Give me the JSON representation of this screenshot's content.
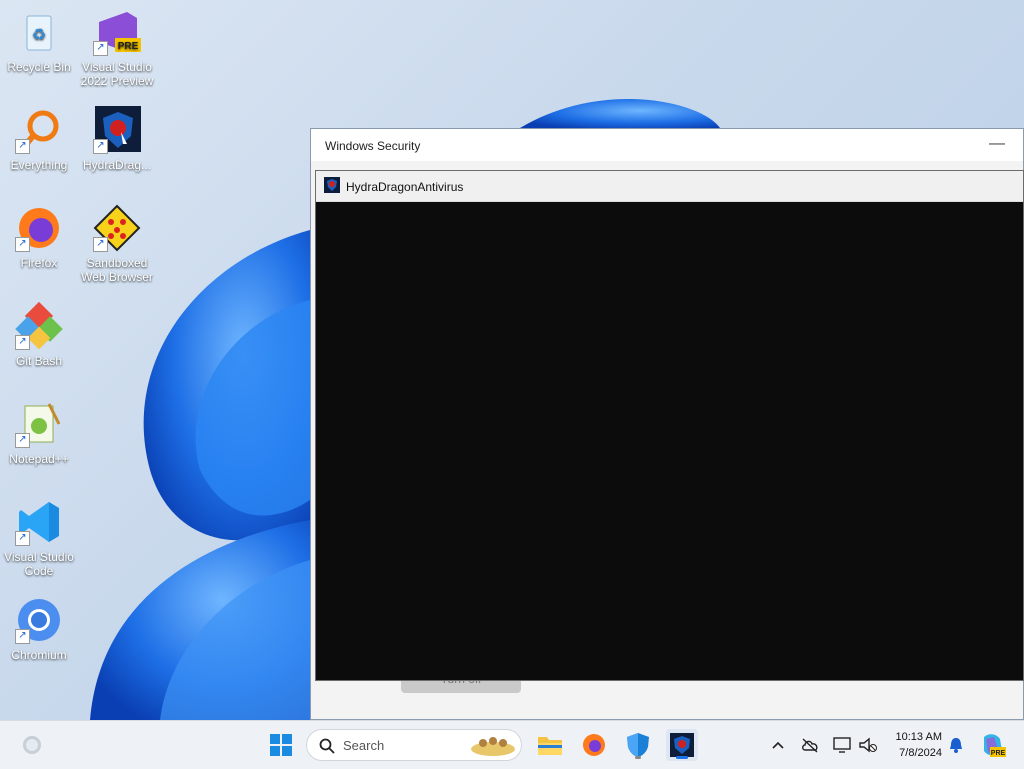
{
  "desktop": {
    "icons": [
      {
        "label": "Recycle Bin",
        "icon": "recycle-bin-icon"
      },
      {
        "label": "Visual Studio 2022 Preview",
        "icon": "visual-studio-icon",
        "badge": "PRE"
      },
      {
        "label": "Everything",
        "icon": "everything-search-icon"
      },
      {
        "label": "HydraDrag...",
        "icon": "hydradragon-icon"
      },
      {
        "label": "Firefox",
        "icon": "firefox-icon"
      },
      {
        "label": "Sandboxed Web Browser",
        "icon": "sandboxed-browser-icon"
      },
      {
        "label": "Git Bash",
        "icon": "git-bash-icon"
      },
      {
        "label": "Notepad++",
        "icon": "notepad-plus-plus-icon"
      },
      {
        "label": "Visual Studio Code",
        "icon": "vscode-icon"
      },
      {
        "label": "Chromium",
        "icon": "chromium-icon"
      }
    ]
  },
  "window": {
    "title": "Windows Security",
    "minimize": "—",
    "ghost_button": "Turn off"
  },
  "console": {
    "title": "HydraDragonAntivirus"
  },
  "taskbar": {
    "search_placeholder": "Search",
    "clock_time": "10:13 AM",
    "clock_date": "7/8/2024",
    "copilot_badge": "PRE"
  },
  "colors": {
    "accent": "#1a73e8",
    "console_bg": "#0c0c0c"
  }
}
